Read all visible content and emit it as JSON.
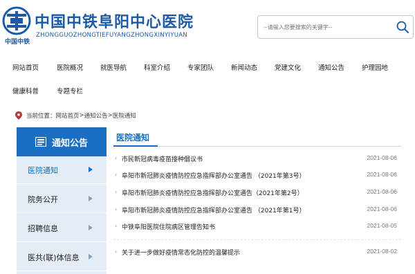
{
  "header": {
    "logo_caption": "中国中铁",
    "title": "中国中铁阜阳中心医院",
    "pinyin": "ZHONGGUOZHONGTIEFUYANGZHONGXINYIYUAN",
    "search_placeholder": "--请输入您要搜索的关键字--",
    "brand_color": "#1a5aa8"
  },
  "nav": {
    "row1": [
      "网站首页",
      "医院概况",
      "就医导航",
      "科室介绍",
      "专家团队",
      "新闻动态",
      "党建文化",
      "通知公告",
      "护理园地"
    ],
    "row2": [
      "健康科普",
      "专题专栏"
    ]
  },
  "breadcrumb": {
    "prefix": "当前位置：",
    "items": [
      "网站首页",
      "通知公告",
      "医院通知"
    ],
    "separator": " > "
  },
  "sidebar": {
    "heading": "通知公告",
    "items": [
      {
        "label": "医院通知",
        "active": true
      },
      {
        "label": "院务公开",
        "active": false
      },
      {
        "label": "招聘信息",
        "active": false
      },
      {
        "label": "医共(联)体信息",
        "active": false
      }
    ],
    "accent_color": "#1a6fc4"
  },
  "main": {
    "title": "医院通知",
    "news": [
      {
        "title": "市民新冠病毒疫苗接种倡议书",
        "date": "2021-08-06"
      },
      {
        "title": "阜阳市新冠肺炎疫情防控应急指挥部办公室通告 （2021年第3号）",
        "date": "2021-08-06"
      },
      {
        "title": "阜阳市新冠肺炎疫情防控应急指挥部办公室通告（2021年第2号）",
        "date": "2021-08-06"
      },
      {
        "title": "阜阳市新冠肺炎疫情防控应急指挥部办公室通告 （2021年第1号）",
        "date": "2021-08-06"
      },
      {
        "title": "中铁阜阳医院住院病区管理告知书",
        "date": "2021-08-05"
      },
      {
        "title": "关于进一步做好疫情常态化防控的温馨提示",
        "date": "2021-08-02"
      }
    ]
  }
}
